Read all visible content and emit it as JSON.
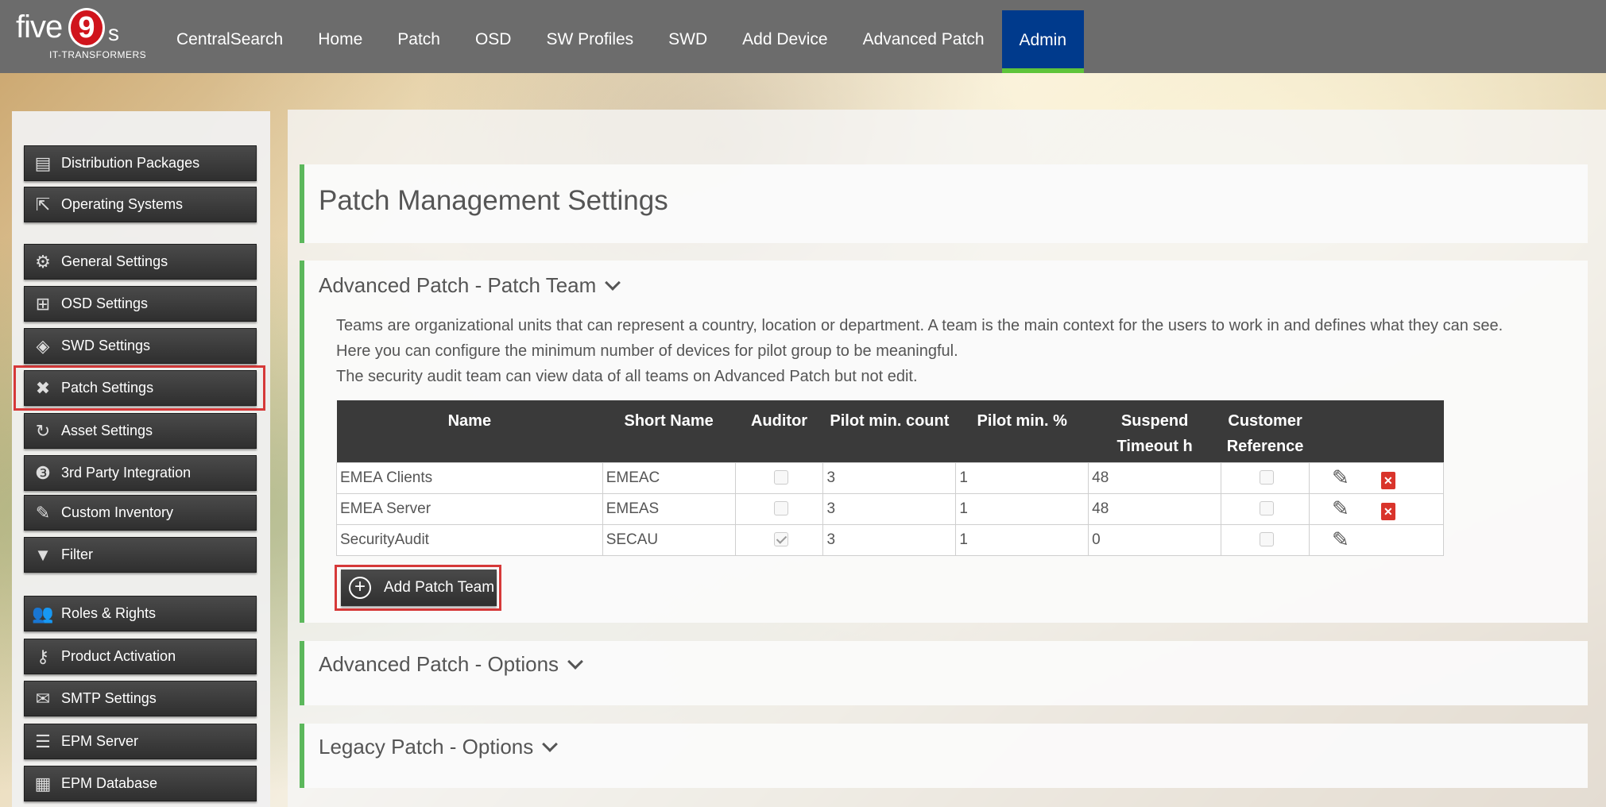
{
  "logo": {
    "word": "five",
    "nine": "9",
    "suffix": "s",
    "tagline": "IT-TRANSFORMERS"
  },
  "nav": [
    {
      "label": "CentralSearch"
    },
    {
      "label": "Home"
    },
    {
      "label": "Patch"
    },
    {
      "label": "OSD"
    },
    {
      "label": "SW Profiles"
    },
    {
      "label": "SWD"
    },
    {
      "label": "Add Device"
    },
    {
      "label": "Advanced Patch"
    },
    {
      "label": "Admin",
      "active": true
    }
  ],
  "sidebar": [
    {
      "label": "Distribution Packages",
      "icon": "package-icon"
    },
    {
      "label": "Operating Systems",
      "icon": "external-link-icon"
    },
    {
      "label": "General Settings",
      "icon": "gear-icon"
    },
    {
      "label": "OSD Settings",
      "icon": "windows-icon"
    },
    {
      "label": "SWD Settings",
      "icon": "software-icon"
    },
    {
      "label": "Patch Settings",
      "icon": "patch-icon",
      "selected": true
    },
    {
      "label": "Asset Settings",
      "icon": "refresh-icon"
    },
    {
      "label": "3rd Party Integration",
      "icon": "integration-icon"
    },
    {
      "label": "Custom Inventory",
      "icon": "pen-icon"
    },
    {
      "label": "Filter",
      "icon": "filter-icon"
    },
    {
      "label": "Roles & Rights",
      "icon": "users-icon"
    },
    {
      "label": "Product Activation",
      "icon": "key-icon"
    },
    {
      "label": "SMTP Settings",
      "icon": "mail-icon"
    },
    {
      "label": "EPM Server",
      "icon": "server-icon"
    },
    {
      "label": "EPM Database",
      "icon": "database-icon"
    }
  ],
  "page": {
    "title": "Patch Management Settings"
  },
  "team_section": {
    "title": "Advanced Patch - Patch Team",
    "description": [
      "Teams are organizational units that can represent a country, location or department. A team is the main context for the users to work in and defines what they can see.",
      "Here you can configure the minimum number of devices for pilot group to be meaningful.",
      "The security audit team can view data of all teams on Advanced Patch but not edit."
    ],
    "columns": [
      "Name",
      "Short Name",
      "Auditor",
      "Pilot min. count",
      "Pilot min. %",
      "Suspend Timeout h",
      "Customer Reference"
    ],
    "rows": [
      {
        "name": "EMEA Clients",
        "short": "EMEAC",
        "auditor": false,
        "pilot_count": "3",
        "pilot_pct": "1",
        "timeout": "48",
        "customer_ref": false,
        "deletable": true
      },
      {
        "name": "EMEA Server",
        "short": "EMEAS",
        "auditor": false,
        "pilot_count": "3",
        "pilot_pct": "1",
        "timeout": "48",
        "customer_ref": false,
        "deletable": true
      },
      {
        "name": "SecurityAudit",
        "short": "SECAU",
        "auditor": true,
        "pilot_count": "3",
        "pilot_pct": "1",
        "timeout": "0",
        "customer_ref": false,
        "deletable": false
      }
    ],
    "add_button": "Add Patch Team"
  },
  "options_section": {
    "title": "Advanced Patch - Options"
  },
  "legacy_section": {
    "title": "Legacy Patch - Options"
  }
}
